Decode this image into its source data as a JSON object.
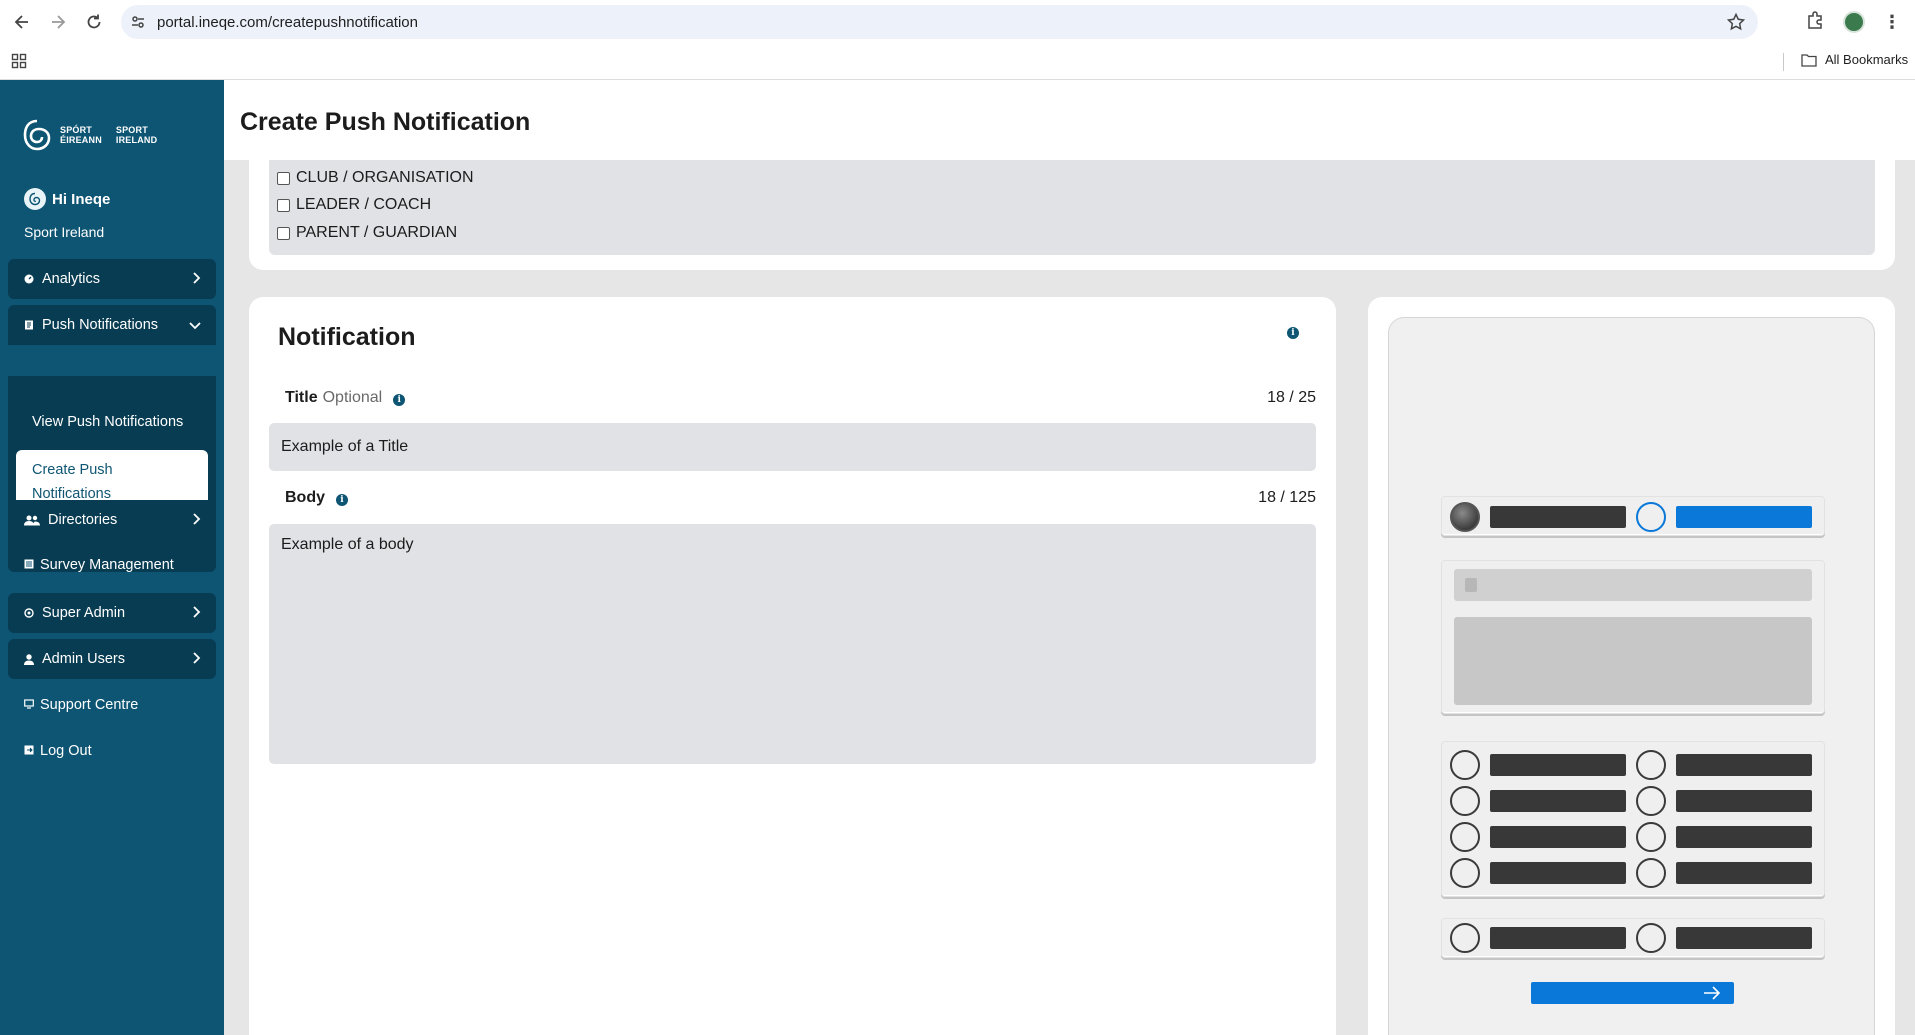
{
  "browser": {
    "url": "portal.ineqe.com/createpushnotification",
    "all_bookmarks": "All Bookmarks"
  },
  "sidebar": {
    "logo_left": [
      "SPÓRT",
      "ÉIREANN"
    ],
    "logo_right": [
      "SPORT",
      "IRELAND"
    ],
    "greeting": "Hi Ineqe",
    "organisation": "Sport Ireland",
    "items": [
      {
        "label": "Analytics"
      },
      {
        "label": "Push Notifications"
      },
      {
        "label": "View Push Notifications"
      },
      {
        "label": "Create Push Notifications"
      },
      {
        "label": "Directories"
      },
      {
        "label": "Survey Management"
      },
      {
        "label": "Super Admin"
      },
      {
        "label": "Admin Users"
      },
      {
        "label": "Support Centre"
      },
      {
        "label": "Log Out"
      }
    ]
  },
  "page": {
    "title": "Create Push Notification"
  },
  "audience": {
    "options": [
      {
        "label": "CLUB / ORGANISATION",
        "checked": false
      },
      {
        "label": "LEADER / COACH",
        "checked": false
      },
      {
        "label": "PARENT / GUARDIAN",
        "checked": false
      }
    ]
  },
  "notification": {
    "heading": "Notification",
    "title_label": "Title",
    "title_optional": "Optional",
    "title_counter": "18 / 25",
    "title_value": "Example of a Title",
    "body_label": "Body",
    "body_counter": "18 / 125",
    "body_value": "Example of a body"
  },
  "colors": {
    "sidebar": "#0e5573",
    "sidebar_item": "#083c52",
    "preview_blue": "#0a78d8",
    "field_bg": "#e0e2e6"
  }
}
